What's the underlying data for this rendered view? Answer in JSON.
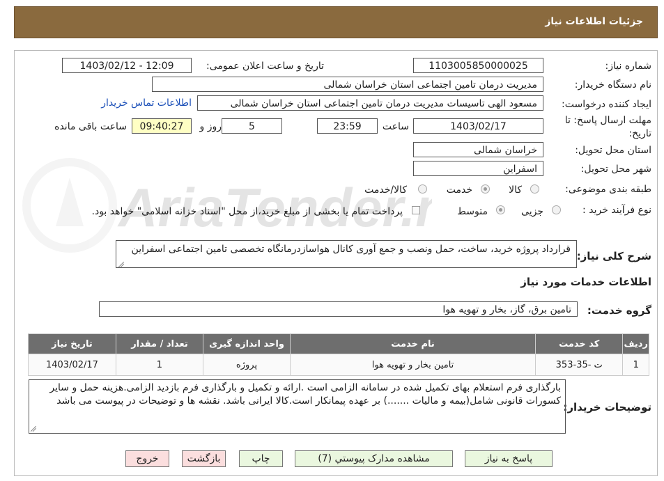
{
  "header": {
    "title": "جزئیات اطلاعات نیاز"
  },
  "fields": {
    "need_number": {
      "label": "شماره نیاز:",
      "value": "1103005850000025"
    },
    "announce": {
      "label": "تاریخ و ساعت اعلان عمومی:",
      "value": "1403/02/12 - 12:09"
    },
    "buyer_org": {
      "label": "نام دستگاه خریدار:",
      "value": "مدیریت درمان تامین اجتماعی استان خراسان شمالی"
    },
    "requester": {
      "label": "ایجاد کننده درخواست:",
      "value": "مسعود الهی تاسیسات مدیریت درمان تامین اجتماعی استان خراسان شمالی",
      "contact_link": "اطلاعات تماس خریدار"
    },
    "deadline": {
      "label": "مهلت ارسال پاسخ: تا تاریخ:",
      "date": "1403/02/17",
      "time_label": "ساعت",
      "time": "23:59",
      "days": "5",
      "days_label": "روز و",
      "remaining": "09:40:27",
      "remaining_label": "ساعت باقی مانده"
    },
    "province": {
      "label": "استان محل تحویل:",
      "value": "خراسان شمالی"
    },
    "city": {
      "label": "شهر محل تحویل:",
      "value": "اسفراین"
    },
    "category": {
      "label": "طبقه بندی موضوعی:",
      "options": [
        "کالا",
        "خدمت",
        "کالا/خدمت"
      ],
      "selected": "خدمت"
    },
    "process": {
      "label": "نوع فرآیند خرید :",
      "options": [
        "جزیی",
        "متوسط"
      ],
      "selected": "متوسط",
      "payment_note": "پرداخت تمام یا بخشی از مبلغ خرید،از محل \"اسناد خزانه اسلامی\" خواهد بود."
    },
    "summary": {
      "label": "شرح کلی نیاز:",
      "value": "قرارداد پروژه  خرید، ساخت، حمل ونصب و جمع آوری کانال هواسازدرمانگاه تخصصی تامین اجتماعی اسفراین"
    }
  },
  "services": {
    "section_title": "اطلاعات خدمات مورد نیاز",
    "group_label": "گروه خدمت:",
    "group_value": "تامین برق، گاز، بخار و تهویه هوا",
    "columns": [
      "ردیف",
      "کد خدمت",
      "نام خدمت",
      "واحد اندازه گیری",
      "تعداد / مقدار",
      "تاریخ نیاز"
    ],
    "rows": [
      [
        "1",
        "ت -35-353",
        "تامین بخار و تهویه هوا",
        "پروژه",
        "1",
        "1403/02/17"
      ]
    ]
  },
  "buyer_notes": {
    "label": "توضیحات خریدار:",
    "value": "بارگذاری فرم استعلام بهای تکمیل شده در سامانه الزامی است .ارائه و تکمیل و بارگذاری فرم بازدید الزامی.هزینه حمل و سایر کسورات قانونی شامل(بیمه و مالیات .......) بر عهده پیمانکار است.کالا ایرانی باشد.   نقشه ها و توضیحات در پیوست می باشد"
  },
  "buttons": {
    "reply": "پاسخ به نیاز",
    "attachments": "مشاهده مدارک پیوستي (7)",
    "print": "چاپ",
    "back": "بازگشت",
    "exit": "خروج"
  },
  "watermark": {
    "text": "AriaTender.neT"
  },
  "colors": {
    "header_bg": "#8a6a3e",
    "grid_header": "#6e6e6e",
    "button_green": "#eaf7df",
    "button_pink": "#fbdede",
    "link": "#1b4fb8"
  }
}
